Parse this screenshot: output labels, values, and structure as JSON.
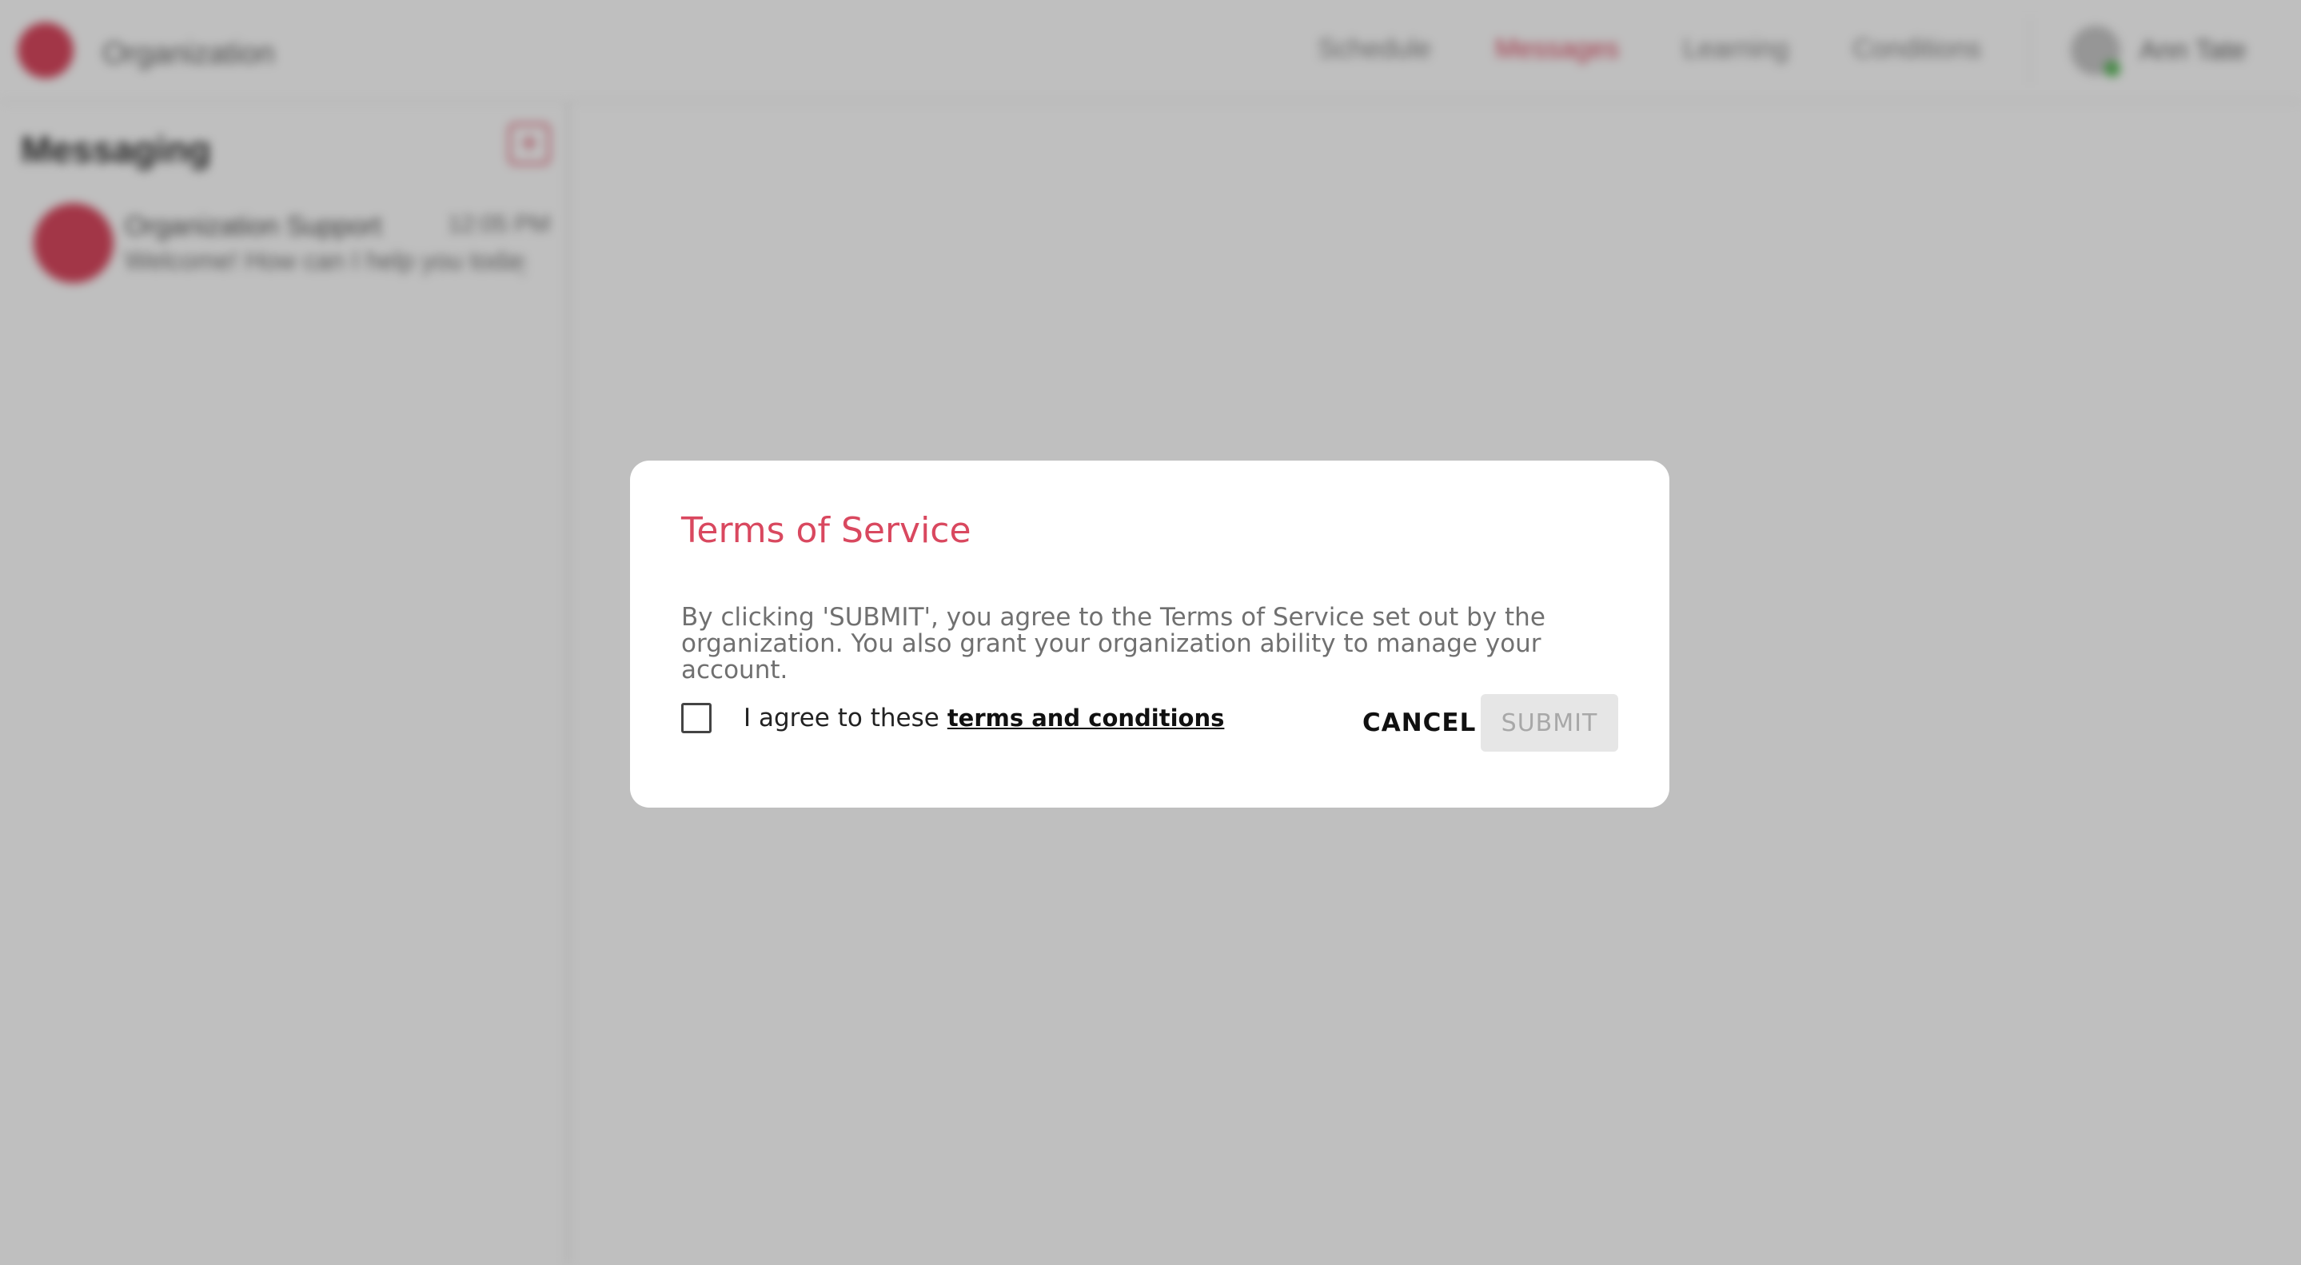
{
  "app": {
    "org_selector": "Organization",
    "nav": [
      "Schedule",
      "Messages",
      "Learning",
      "Conditions"
    ],
    "active_nav": "Messages",
    "user_name": "Ann Tate"
  },
  "sidebar": {
    "title": "Messaging",
    "new_message_icon": "+",
    "conversation": {
      "name": "Organization Support",
      "time": "12:05 PM",
      "preview": "Welcome! How can I help you today?"
    }
  },
  "modal": {
    "title": "Terms of Service",
    "body": "By clicking 'SUBMIT', you agree to the Terms of Service set out by the organization. You also grant your organization ability to manage your account.",
    "agree_label": "I agree to these",
    "terms_link": "terms and conditions",
    "cancel_label": "CANCEL",
    "submit_label": "SUBMIT",
    "checkbox_checked": false,
    "submit_enabled": false
  },
  "colors": {
    "accent": "#d9485f",
    "overlay": "rgba(0,0,0,0.25)"
  }
}
